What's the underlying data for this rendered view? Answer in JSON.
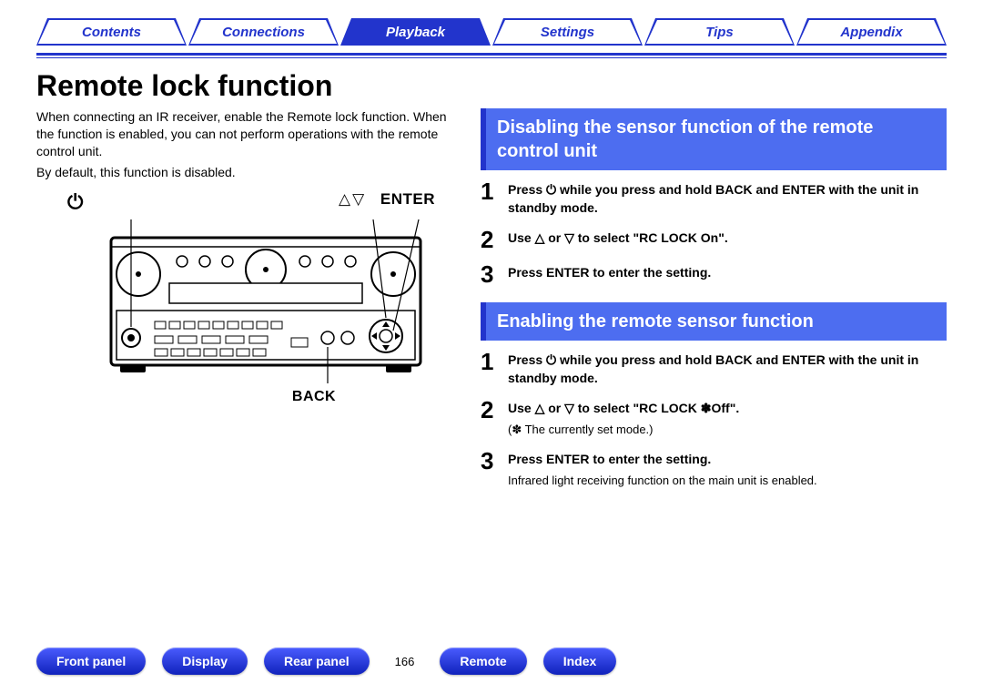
{
  "nav": {
    "tabs": [
      {
        "label": "Contents",
        "active": false
      },
      {
        "label": "Connections",
        "active": false
      },
      {
        "label": "Playback",
        "active": true
      },
      {
        "label": "Settings",
        "active": false
      },
      {
        "label": "Tips",
        "active": false
      },
      {
        "label": "Appendix",
        "active": false
      }
    ]
  },
  "page_title": "Remote lock function",
  "intro": {
    "p1": "When connecting an IR receiver, enable the Remote lock function. When the function is enabled, you can not perform operations with the remote control unit.",
    "p2": "By default, this function is disabled."
  },
  "diagram": {
    "top_left_icon": "⏻",
    "top_right_arrows": "△▽",
    "top_right_label": "ENTER",
    "bottom_label": "BACK"
  },
  "section1": {
    "title": "Disabling the sensor function of the remote control unit",
    "steps": [
      {
        "num": "1",
        "main": "Press ⏻ while you press and hold BACK and ENTER with the unit in standby mode."
      },
      {
        "num": "2",
        "main": "Use △ or ▽ to select \"RC LOCK On\"."
      },
      {
        "num": "3",
        "main": "Press ENTER to enter the setting."
      }
    ]
  },
  "section2": {
    "title": "Enabling the remote sensor function",
    "steps": [
      {
        "num": "1",
        "main": "Press ⏻ while you press and hold BACK and ENTER with the unit in standby mode."
      },
      {
        "num": "2",
        "main": "Use △ or ▽ to select \"RC LOCK ✽Off\".",
        "sub": "(✽ The currently set mode.)"
      },
      {
        "num": "3",
        "main": "Press ENTER to enter the setting.",
        "sub": "Infrared light receiving function on the main unit is enabled."
      }
    ]
  },
  "footer": {
    "buttons": [
      "Front panel",
      "Display",
      "Rear panel"
    ],
    "page_number": "166",
    "buttons_right": [
      "Remote",
      "Index"
    ]
  }
}
